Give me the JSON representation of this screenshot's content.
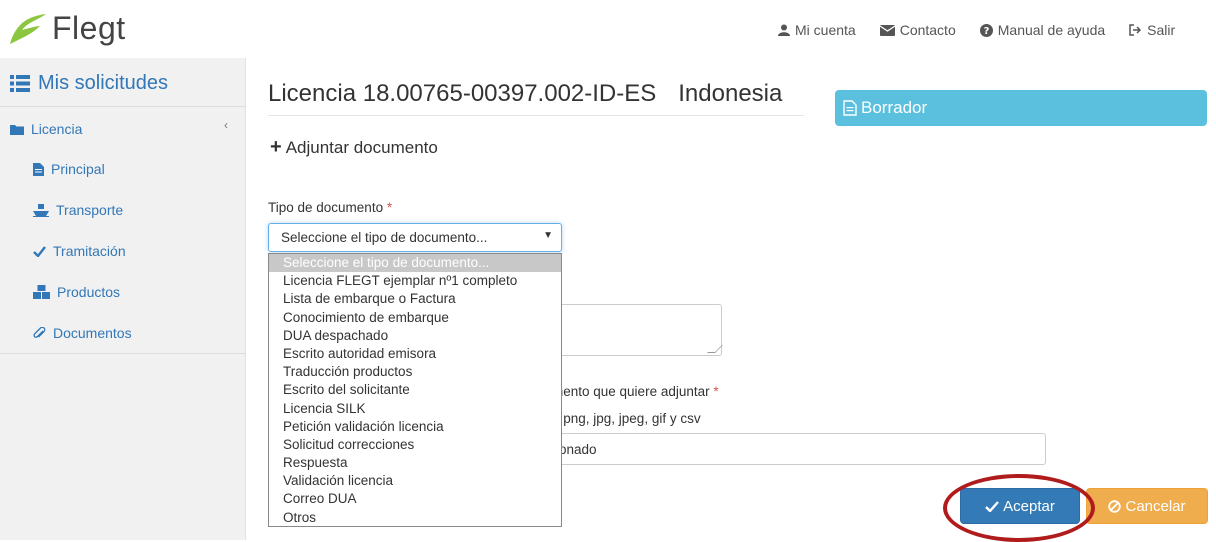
{
  "header": {
    "logo_text": "Flegt",
    "nav": [
      {
        "label": "Mi cuenta",
        "icon": "user-icon"
      },
      {
        "label": "Contacto",
        "icon": "envelope-icon"
      },
      {
        "label": "Manual de ayuda",
        "icon": "question-circle-icon"
      },
      {
        "label": "Salir",
        "icon": "sign-out-icon"
      }
    ]
  },
  "sidebar": {
    "title": "Mis solicitudes",
    "section": "Licencia",
    "items": [
      {
        "label": "Principal",
        "icon": "file-icon"
      },
      {
        "label": "Transporte",
        "icon": "ship-icon"
      },
      {
        "label": "Tramitación",
        "icon": "check-icon"
      },
      {
        "label": "Productos",
        "icon": "cubes-icon"
      },
      {
        "label": "Documentos",
        "icon": "paperclip-icon"
      }
    ]
  },
  "main": {
    "title": "Licencia 18.00765-00397.002-ID-ES",
    "country": "Indonesia",
    "status": "Borrador",
    "attach_heading": "Adjuntar documento",
    "doc_type_label": "Tipo de documento",
    "required_mark": "*",
    "select_value": "Seleccione el tipo de documento...",
    "file_label_partial": "mento que quiere adjuntar",
    "file_types_partial": "t, png, jpg, jpeg, gif y csv",
    "file_input_partial": "ionado",
    "dropdown_options": [
      "Seleccione el tipo de documento...",
      "Licencia FLEGT ejemplar nº1 completo",
      "Lista de embarque o Factura",
      "Conocimiento de embarque",
      "DUA despachado",
      "Escrito autoridad emisora",
      "Traducción productos",
      "Escrito del solicitante",
      "Licencia SILK",
      "Petición validación licencia",
      "Solicitud correcciones",
      "Respuesta",
      "Validación licencia",
      "Correo DUA",
      "Otros"
    ],
    "accept_label": "Aceptar",
    "cancel_label": "Cancelar"
  },
  "colors": {
    "accent": "#3277b7",
    "status_bg": "#5bc0de",
    "accept_bg": "#337ab7",
    "cancel_bg": "#f0ad4e",
    "highlight_ring": "#b01b1b",
    "logo_leaf": "#8cc63f"
  }
}
